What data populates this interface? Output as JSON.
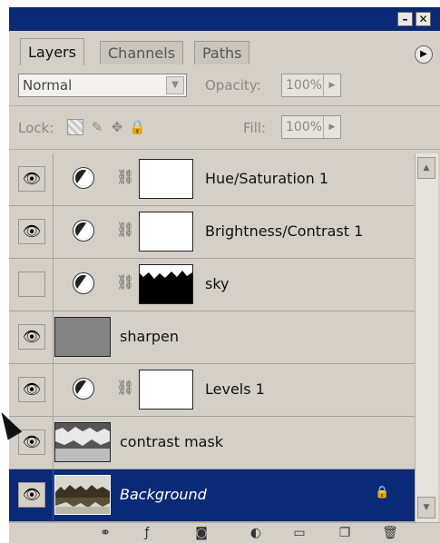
{
  "window": {
    "minimize_glyph": "–",
    "close_glyph": "✕",
    "menu_glyph": "▶"
  },
  "tabs": [
    {
      "label": "Layers",
      "active": true
    },
    {
      "label": "Channels",
      "active": false
    },
    {
      "label": "Paths",
      "active": false
    }
  ],
  "blend_mode": {
    "value": "Normal",
    "arrow": "▼"
  },
  "opacity": {
    "label": "Opacity:",
    "value": "100%",
    "arrow": "▶"
  },
  "lock": {
    "label": "Lock:",
    "icons": [
      "lock-transparent-icon",
      "lock-image-icon",
      "lock-position-icon",
      "lock-all-icon"
    ]
  },
  "fill": {
    "label": "Fill:",
    "value": "100%",
    "arrow": "▶"
  },
  "layers": [
    {
      "name": "Hue/Saturation 1",
      "visible": true,
      "type": "adjustment",
      "mask": "white"
    },
    {
      "name": "Brightness/Contrast 1",
      "visible": true,
      "type": "adjustment",
      "mask": "white"
    },
    {
      "name": "sky",
      "visible": false,
      "type": "adjustment",
      "mask": "sky-mask"
    },
    {
      "name": "sharpen",
      "visible": true,
      "type": "pixel",
      "thumb": "gray"
    },
    {
      "name": "Levels 1",
      "visible": true,
      "type": "adjustment",
      "mask": "white"
    },
    {
      "name": "contrast mask",
      "visible": true,
      "type": "pixel",
      "thumb": "contrast"
    },
    {
      "name": "Background",
      "visible": true,
      "type": "background",
      "thumb": "landscape",
      "selected": true,
      "locked": true
    }
  ],
  "footer_icons": [
    "link-icon",
    "layer-style-icon",
    "add-mask-icon",
    "new-adjustment-icon",
    "new-group-icon",
    "new-layer-icon",
    "trash-icon"
  ],
  "colors": {
    "title_bar": "#0a2a78",
    "selected_row": "#0a2a78",
    "panel_bg": "#d5d0c7"
  }
}
